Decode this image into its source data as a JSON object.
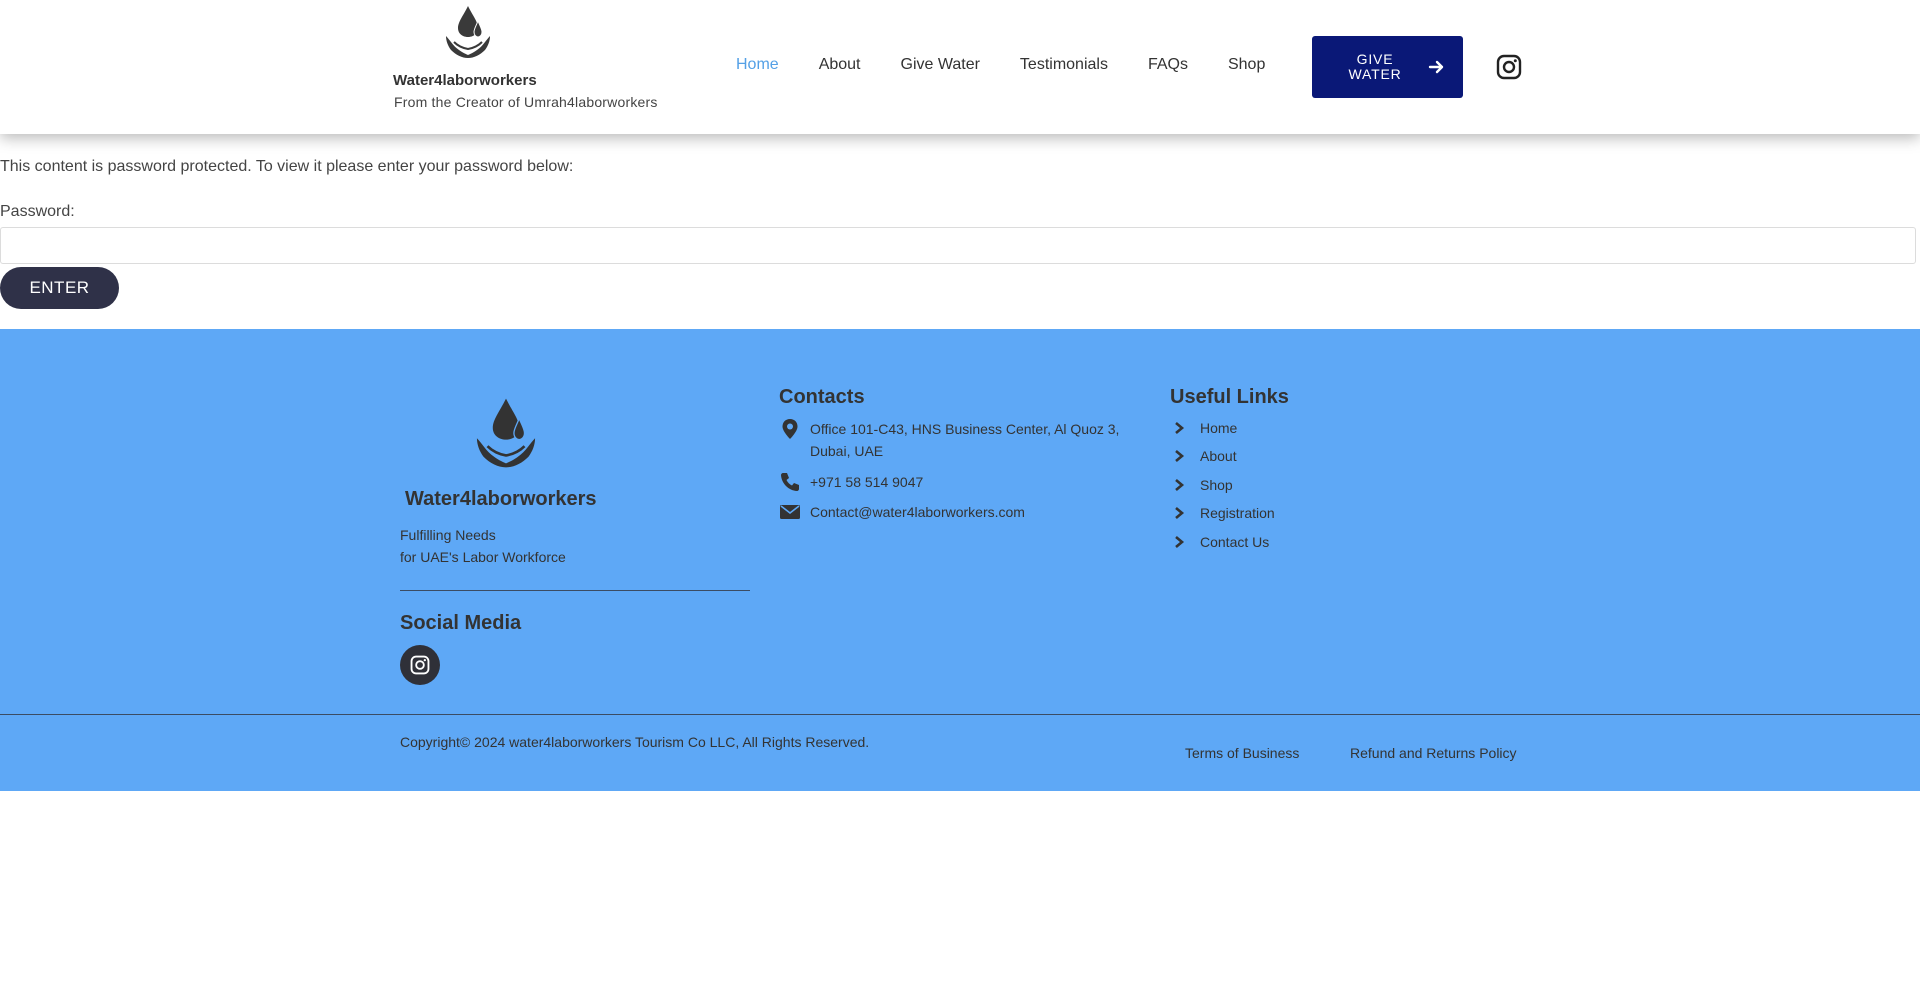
{
  "header": {
    "brand_name": "Water4laborworkers",
    "tagline": "From the Creator of  Umrah4laborworkers",
    "nav": [
      {
        "label": "Home",
        "active": true
      },
      {
        "label": "About",
        "active": false
      },
      {
        "label": "Give Water",
        "active": false
      },
      {
        "label": "Testimonials",
        "active": false
      },
      {
        "label": "FAQs",
        "active": false
      },
      {
        "label": "Shop",
        "active": false
      }
    ],
    "cta_label": "GIVE WATER",
    "cta_icon": "arrow-right-icon",
    "social_icon": "instagram-icon"
  },
  "content": {
    "protected_message": "This content is password protected. To view it please enter your password below:",
    "password_label": "Password:",
    "password_value": "",
    "enter_label": "ENTER"
  },
  "footer": {
    "brand_name": "Water4laborworkers",
    "tagline_line1": "Fulfilling Needs",
    "tagline_line2": "for UAE's Labor Workforce",
    "social_heading": "Social Media",
    "contacts_heading": "Contacts",
    "contacts": [
      {
        "icon": "location-pin-icon",
        "text_line1": "Office 101-C43, HNS Business Center, Al Quoz 3,",
        "text_line2": "Dubai, UAE"
      },
      {
        "icon": "phone-icon",
        "text_line1": "+971 58 514 9047",
        "text_line2": ""
      },
      {
        "icon": "envelope-icon",
        "text_line1": "Contact@water4laborworkers.com",
        "text_line2": ""
      }
    ],
    "links_heading": "Useful Links",
    "links": [
      "Home",
      "About",
      "Shop",
      "Registration",
      "Contact Us"
    ],
    "copyright": "Copyright© 2024 water4laborworkers Tourism Co LLC, All Rights Reserved.",
    "policies": [
      "Terms of Business",
      "Refund and Returns Policy"
    ]
  },
  "colors": {
    "accent_nav_active": "#54a0e6",
    "cta_background": "#0a1877",
    "footer_background": "#5ea8f6",
    "enter_button": "#2f3148"
  }
}
